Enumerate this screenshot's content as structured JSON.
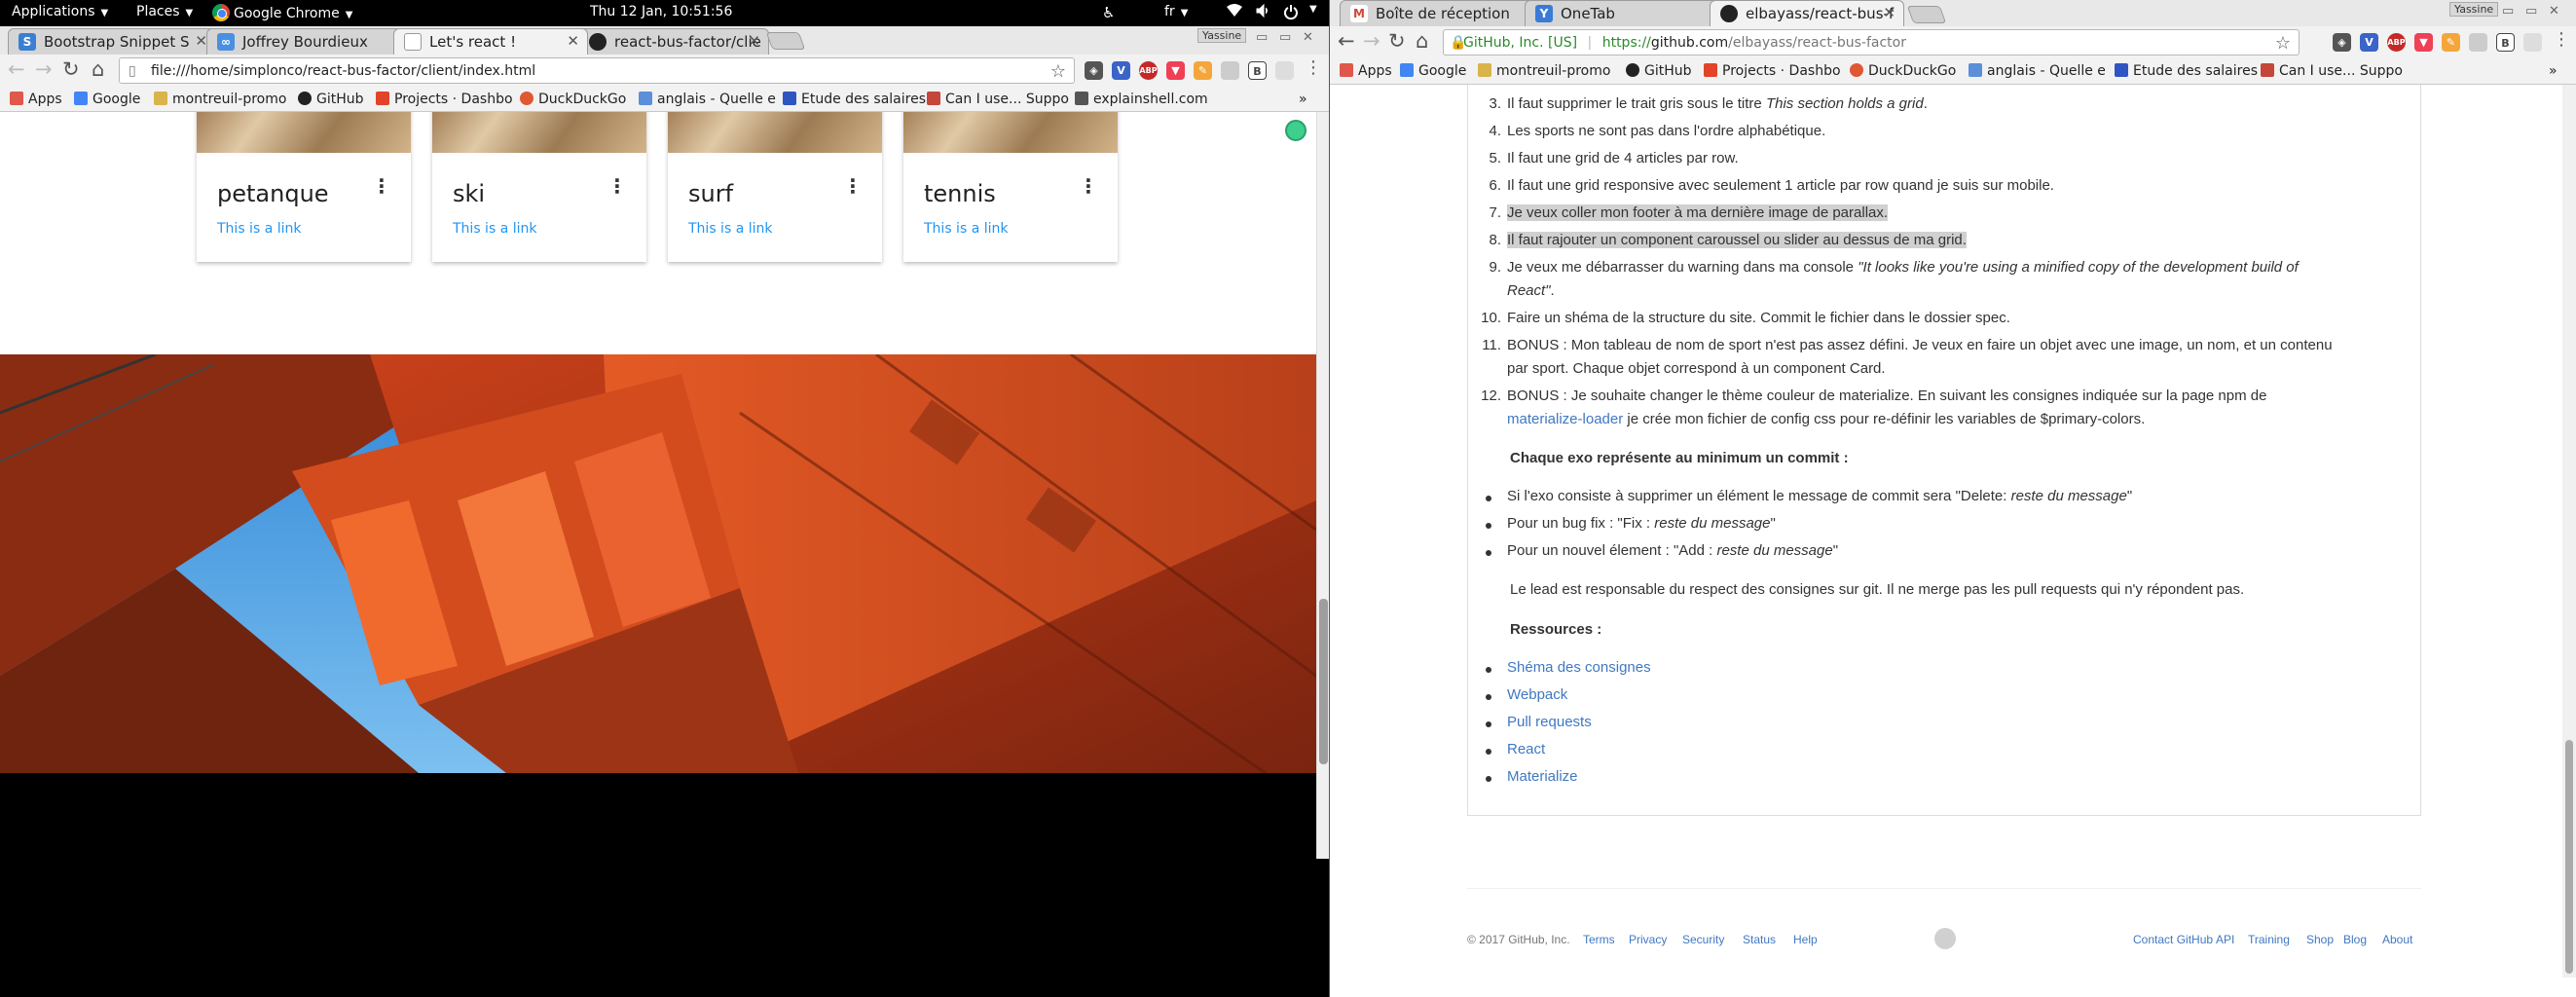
{
  "topbar": {
    "applications": "Applications",
    "places": "Places",
    "app_name": "Google Chrome",
    "clock": "Thu 12 Jan, 10:51:56",
    "language": "fr"
  },
  "left_browser": {
    "user_badge": "Yassine",
    "tabs": [
      {
        "title": "Bootstrap Snippet S",
        "active": false,
        "favicon_color": "#3b7fd4"
      },
      {
        "title": "Joffrey Bourdieux",
        "active": false,
        "favicon_color": "#4a90e2"
      },
      {
        "title": "Let's react !",
        "active": true,
        "favicon_color": "#cccccc"
      },
      {
        "title": "react-bus-factor/clie",
        "active": false,
        "favicon_color": "#222222"
      }
    ],
    "url": "file:///home/simplonco/react-bus-factor/client/index.html",
    "bookmarks": [
      {
        "label": "Apps",
        "color": "#e0574b"
      },
      {
        "label": "Google",
        "color": "#4285f4"
      },
      {
        "label": "montreuil-promo",
        "color": "#d9b44a"
      },
      {
        "label": "GitHub",
        "color": "#222222"
      },
      {
        "label": "Projects · Dashbo",
        "color": "#e24329"
      },
      {
        "label": "DuckDuckGo",
        "color": "#de5833"
      },
      {
        "label": "anglais - Quelle e",
        "color": "#5b8fd9"
      },
      {
        "label": "Etude des salaires",
        "color": "#2f55c2"
      },
      {
        "label": "Can I use... Suppo",
        "color": "#c4473a"
      },
      {
        "label": "explainshell.com",
        "color": "#555555"
      }
    ],
    "more_bookmarks": "»",
    "cards": [
      {
        "title": "petanque",
        "link": "This is a link"
      },
      {
        "title": "ski",
        "link": "This is a link"
      },
      {
        "title": "surf",
        "link": "This is a link"
      },
      {
        "title": "tennis",
        "link": "This is a link"
      }
    ],
    "menu_dots": "⋮"
  },
  "right_browser": {
    "user_badge": "Yassine",
    "tabs": [
      {
        "title": "Boîte de réception",
        "active": false,
        "favicon_color": "#d44638"
      },
      {
        "title": "OneTab",
        "active": false,
        "favicon_color": "#3a7bd5"
      },
      {
        "title": "elbayass/react-bus-f",
        "active": true,
        "favicon_color": "#222222"
      }
    ],
    "security_label": "GitHub, Inc. [US]",
    "url_prefix": "https://",
    "url_host": "github.com",
    "url_path": "/elbayass/react-bus-factor",
    "bookmarks": [
      {
        "label": "Apps",
        "color": "#e0574b"
      },
      {
        "label": "Google",
        "color": "#4285f4"
      },
      {
        "label": "montreuil-promo",
        "color": "#d9b44a"
      },
      {
        "label": "GitHub",
        "color": "#222222"
      },
      {
        "label": "Projects · Dashbo",
        "color": "#e24329"
      },
      {
        "label": "DuckDuckGo",
        "color": "#de5833"
      },
      {
        "label": "anglais - Quelle e",
        "color": "#5b8fd9"
      },
      {
        "label": "Etude des salaires",
        "color": "#2f55c2"
      },
      {
        "label": "Can I use... Suppo",
        "color": "#c4473a"
      }
    ],
    "more_bookmarks": "»",
    "readme": {
      "ordered_items": [
        {
          "n": "3.",
          "text": "Il faut supprimer le trait gris sous le titre ",
          "em": "This section holds a grid",
          "after": ".",
          "highlight": false
        },
        {
          "n": "4.",
          "text": "Les sports ne sont pas dans l'ordre alphabétique.",
          "highlight": false
        },
        {
          "n": "5.",
          "text": "Il faut une grid de 4 articles par row.",
          "highlight": false
        },
        {
          "n": "6.",
          "text": "Il faut une grid responsive avec seulement 1 article par row quand je suis sur mobile.",
          "highlight": false
        },
        {
          "n": "7.",
          "text": "Je veux coller mon footer à ma dernière image de parallax.",
          "highlight": true
        },
        {
          "n": "8.",
          "text": "Il faut rajouter un component caroussel ou slider au dessus de ma grid.",
          "highlight": true
        },
        {
          "n": "9.",
          "text": "Je veux me débarrasser du warning dans ma console ",
          "em": "\"It looks like you're using a minified copy of the development build of React\"",
          "after": ".",
          "highlight": false
        },
        {
          "n": "10.",
          "text": "Faire un shéma de la structure du site. Commit le fichier dans le dossier spec.",
          "highlight": false
        },
        {
          "n": "11.",
          "text": "BONUS : Mon tableau de nom de sport n'est pas assez défini. Je veux en faire un objet avec une image, un nom, et un contenu par sport. Chaque objet correspond à un component Card.",
          "highlight": false
        },
        {
          "n": "12.",
          "text": "BONUS : Je souhaite changer le thème couleur de materialize. En suivant les consignes indiquée sur la page npm de ",
          "link": "materialize-loader",
          "after": " je crée mon fichier de config css pour re-définir les variables de $primary-colors.",
          "highlight": false
        }
      ],
      "commit_heading": "Chaque exo représente au minimum un commit :",
      "commit_rules": [
        {
          "text": "Si l'exo consiste à supprimer un élément le message de commit sera \"Delete: ",
          "em": "reste du message",
          "after": "\""
        },
        {
          "text": "Pour un bug fix : \"Fix : ",
          "em": "reste du message",
          "after": "\""
        },
        {
          "text": "Pour un nouvel élement : \"Add : ",
          "em": "reste du message",
          "after": "\""
        }
      ],
      "lead_paragraph": "Le lead est responsable du respect des consignes sur git. Il ne merge pas les pull requests qui n'y répondent pas.",
      "resources_heading": "Ressources :",
      "resources": [
        "Shéma des consignes",
        "Webpack",
        "Pull requests",
        "React",
        "Materialize"
      ]
    },
    "footer": {
      "copyright": "© 2017 GitHub, Inc.",
      "left_links": [
        "Terms",
        "Privacy",
        "Security",
        "Status",
        "Help"
      ],
      "right_links": [
        "Contact GitHub",
        "API",
        "Training",
        "Shop",
        "Blog",
        "About"
      ]
    }
  }
}
